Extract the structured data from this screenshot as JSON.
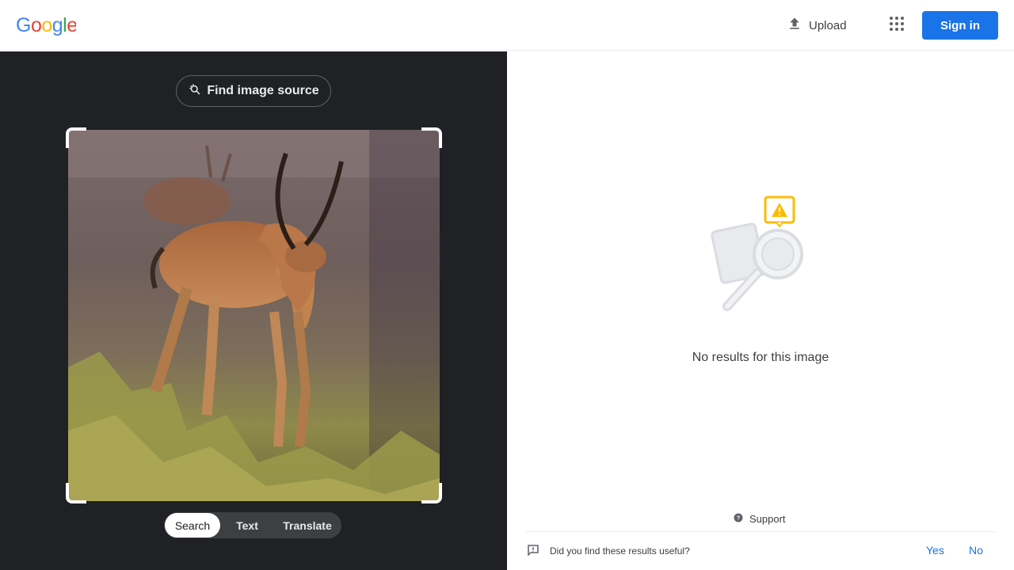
{
  "header": {
    "logo_text": "Google",
    "upload_label": "Upload",
    "signin_label": "Sign in",
    "colors": {
      "blue": "#4285F4",
      "red": "#EA4335",
      "yellow": "#FBBC05",
      "green": "#34A853",
      "signin": "#1a73e8"
    }
  },
  "lens": {
    "find_source_label": "Find image source",
    "tabs": [
      {
        "label": "Search",
        "active": true
      },
      {
        "label": "Text",
        "active": false
      },
      {
        "label": "Translate",
        "active": false
      }
    ]
  },
  "results": {
    "empty_message": "No results for this image",
    "support_label": "Support",
    "feedback_question": "Did you find these results useful?",
    "feedback_yes": "Yes",
    "feedback_no": "No"
  },
  "icons": [
    "upload-icon",
    "apps-grid-icon",
    "lens-search-icon",
    "help-icon",
    "feedback-icon",
    "warning-icon",
    "magnifier-icon"
  ]
}
